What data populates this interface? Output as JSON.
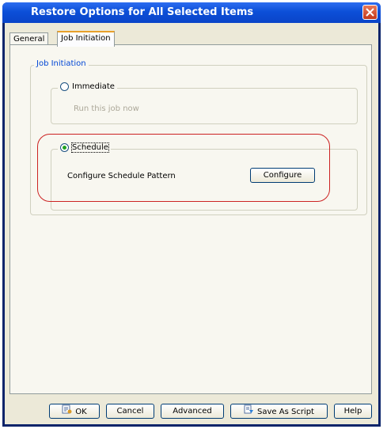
{
  "window": {
    "title": "Restore Options for All Selected Items"
  },
  "tabs": [
    {
      "label": "General",
      "selected": false
    },
    {
      "label": "Job Initiation",
      "selected": true
    }
  ],
  "job_initiation": {
    "legend": "Job Initiation",
    "immediate": {
      "label": "Immediate",
      "description": "Run this job now",
      "selected": false
    },
    "schedule": {
      "label": "Schedule",
      "selected": true,
      "pattern_label": "Configure Schedule Pattern",
      "configure_label": "Configure"
    }
  },
  "footer": {
    "ok_label": "OK",
    "cancel_label": "Cancel",
    "advanced_label": "Advanced",
    "save_script_label": "Save As Script",
    "help_label": "Help"
  },
  "colors": {
    "titlebar": "#0c4fd8",
    "annotation": "#cc2222",
    "legend_text": "#0046d5"
  }
}
